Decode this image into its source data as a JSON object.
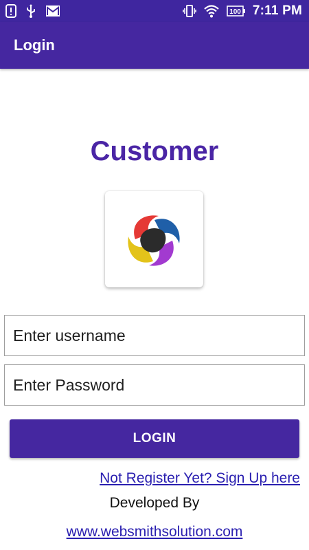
{
  "status_bar": {
    "time": "7:11 PM",
    "battery": "100",
    "icons": [
      "alert-icon",
      "usb-icon",
      "gmail-icon",
      "vibrate-icon",
      "wifi-icon",
      "battery-icon"
    ]
  },
  "app_bar": {
    "title": "Login"
  },
  "main": {
    "heading": "Customer",
    "logo": "app-logo",
    "username": {
      "placeholder": "Enter username",
      "value": ""
    },
    "password": {
      "placeholder": "Enter Password",
      "value": ""
    },
    "login_button": "LOGIN",
    "signup_link": "Not Register Yet? Sign Up here",
    "developed_by": "Developed By",
    "website_link": "www.websmithsolution.com"
  },
  "colors": {
    "primary": "#4527a0",
    "status_bar": "#3f269f",
    "heading": "#4a25a5",
    "link": "#2a1fb0"
  }
}
